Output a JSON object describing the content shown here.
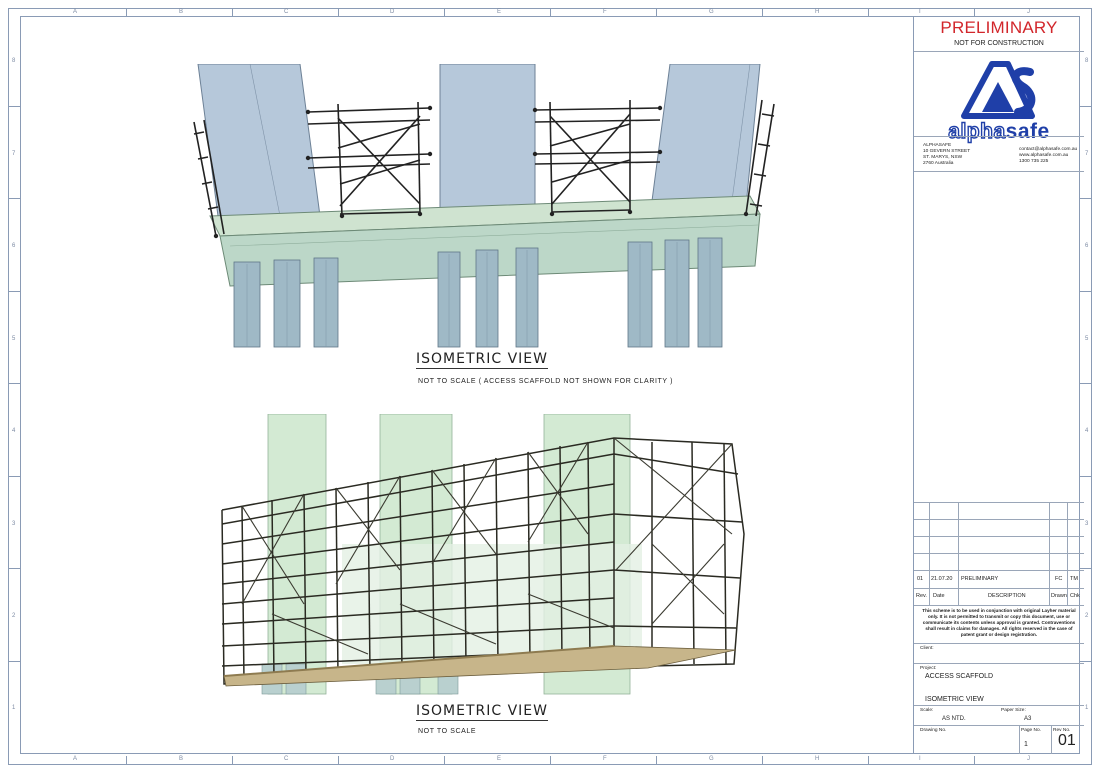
{
  "zones": {
    "columns": [
      "A",
      "B",
      "C",
      "D",
      "E",
      "F",
      "G",
      "H",
      "I",
      "J"
    ],
    "rows": [
      "8",
      "7",
      "6",
      "5",
      "4",
      "3",
      "2",
      "1"
    ]
  },
  "views": [
    {
      "title": "ISOMETRIC VIEW",
      "note": "NOT TO SCALE  ( ACCESS SCAFFOLD NOT SHOWN FOR CLARITY )"
    },
    {
      "title": "ISOMETRIC VIEW",
      "note": "NOT TO SCALE"
    }
  ],
  "title_block": {
    "status": "PRELIMINARY",
    "status_note": "NOT FOR CONSTRUCTION",
    "logo": {
      "mark": "AS",
      "word_left": "alpha",
      "word_right": "safe"
    },
    "address": [
      "ALPHASAFE",
      "10 GEVERN STREET",
      "ST. MARYS, NSW",
      "2760 Australia"
    ],
    "contact": [
      "contact@alphasafe.com.au",
      "www.alphasafe.com.au",
      "1300 735 225"
    ],
    "revision": {
      "rev": "01",
      "date": "21.07.20",
      "description": "PRELIMINARY",
      "drawn": "FC",
      "checked": "TM"
    },
    "revision_headers": {
      "rev": "Rev.",
      "date": "Date",
      "description": "DESCRIPTION",
      "drawn": "Drawn",
      "checked": "Chk"
    },
    "disclaimer": "This scheme is to be used in conjunction with original Layher material only. It is not permitted to transmit or copy this document, use or communicate its contents unless approval is granted. Contraventions shall result in claims for damages. All rights reserved in the case of patent grant or design registration.",
    "client_label": "Client:",
    "project_label": "Project:",
    "project": "ACCESS SCAFFOLD",
    "drawing_title": "ISOMETRIC VIEW",
    "scale_label": "Scale:",
    "scale": "AS NTD.",
    "paper_label": "Paper Size:",
    "paper": "A3",
    "drawing_no_label": "Drawing No.",
    "page_label": "Page No.",
    "page": "1",
    "rev_label": "Rev No.",
    "rev_no": "01"
  },
  "colors": {
    "status_red": "#d2262b",
    "logo_blue": "#1f3fa8",
    "structure_blue": "#a9bfd4",
    "structure_green": "#cfe6cf",
    "scaffold_dark": "#2a2a22"
  }
}
